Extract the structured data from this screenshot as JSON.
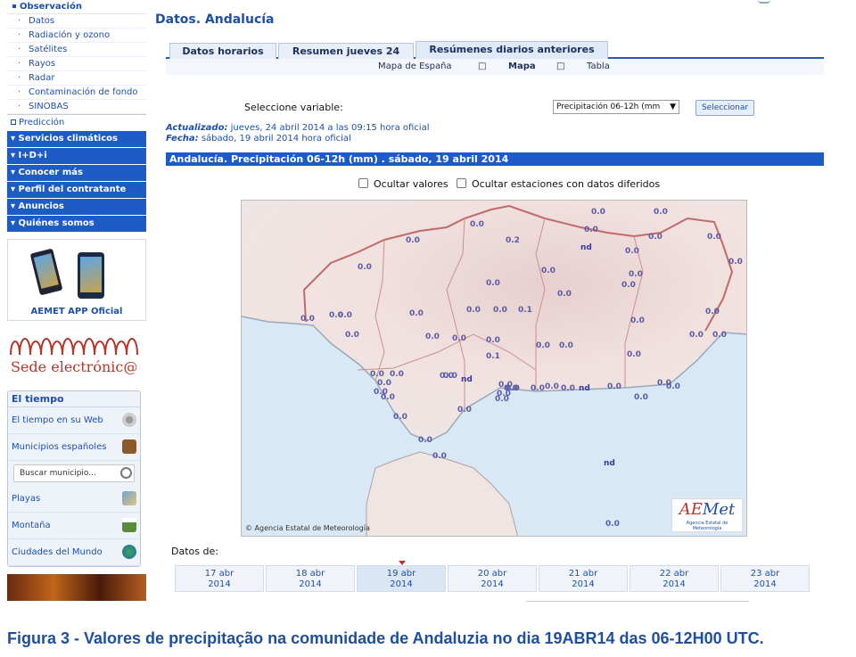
{
  "sidebar": {
    "observacion": {
      "title": "Observación",
      "items": [
        "Datos",
        "Radiación y ozono",
        "Satélites",
        "Rayos",
        "Radar",
        "Contaminación de fondo",
        "SINOBAS"
      ]
    },
    "prediccion": "Predicción",
    "nav": [
      "Servicios climáticos",
      "I+D+i",
      "Conocer más",
      "Perfil del contratante",
      "Anuncios",
      "Quiénes somos"
    ],
    "app_label": "AEMET APP Oficial",
    "sede_label": "Sede electrónic@",
    "tiempo": {
      "title": "El tiempo",
      "rows": [
        "El tiempo en su Web",
        "Municipios españoles"
      ],
      "search_placeholder": "Buscar municipio...",
      "rows2": [
        "Playas",
        "Montaña",
        "Ciudades del Mundo"
      ]
    }
  },
  "main": {
    "title": "Datos. Andalucía",
    "tabs": [
      "Datos horarios",
      "Resumen jueves 24",
      "Resúmenes diarios anteriores"
    ],
    "subnav": {
      "mapa_espana": "Mapa de España",
      "sep": "□",
      "mapa": "Mapa",
      "tabla": "Tabla"
    },
    "select_label": "Seleccione variable:",
    "select_value": "Precipitación 06-12h (mm",
    "select_button": "Seleccionar",
    "actualizado_label": "Actualizado:",
    "actualizado_value": "jueves, 24 abril 2014 a las 09:15 hora oficial",
    "fecha_label": "Fecha:",
    "fecha_value": "sábado, 19 abril 2014 hora oficial",
    "bar_title": "Andalucía. Precipitación 06-12h (mm) . sábado, 19 abril 2014",
    "ocultar_valores": "Ocultar valores",
    "ocultar_estaciones": "Ocultar estaciones con datos diferidos",
    "map_copyright": "© Agencia Estatal de Meteorología",
    "logo_text": "AEMet",
    "logo_sub": "Agencia Estatal de Meteorología",
    "map_values": [
      "0.0",
      "0.0",
      "0.0",
      "0.0",
      "0.0",
      "0.2",
      "nd",
      "0.0",
      "0.0",
      "0.0",
      "0.0",
      "0.0",
      "0.0",
      "0.0",
      "0.0",
      "0.0",
      "0.0",
      "0.0",
      "0.0",
      "0.0",
      "0.0",
      "0.0",
      "0.1",
      "0.0",
      "0.0",
      "0.0",
      "0.0",
      "0.0",
      "0.0",
      "0.0",
      "0.1",
      "0.0",
      "0.0",
      "0.0",
      "0.0",
      "0.0",
      "0.0",
      "0.0",
      "nd",
      "0.0",
      "0.0",
      "0.0",
      "nd",
      "0.0",
      "0.0",
      "0.0",
      "0.0",
      "0.0",
      "0.0",
      "0.0",
      "0.0",
      "0.0",
      "0.0",
      "nd",
      "0.0",
      "0.0",
      "0.0",
      "0.0",
      "0.0",
      "0.0",
      "0.0",
      "0.0",
      "0.0",
      "nd",
      "nd"
    ],
    "datos_de": "Datos de:",
    "days": [
      {
        "day": "17 abr",
        "year": "2014"
      },
      {
        "day": "18 abr",
        "year": "2014"
      },
      {
        "day": "19 abr",
        "year": "2014"
      },
      {
        "day": "20 abr",
        "year": "2014"
      },
      {
        "day": "21 abr",
        "year": "2014"
      },
      {
        "day": "22 abr",
        "year": "2014"
      },
      {
        "day": "23 abr",
        "year": "2014"
      }
    ],
    "selected_day_index": 2
  },
  "caption": "Figura 3 - Valores de precipitação na comunidade de Andaluzia no dia 19ABR14 das 06-12H00 UTC.",
  "colors": {
    "accent": "#1e5cc5",
    "link": "#1e4fa8",
    "caption": "#1e4e9c",
    "border_red": "#c0302a"
  }
}
